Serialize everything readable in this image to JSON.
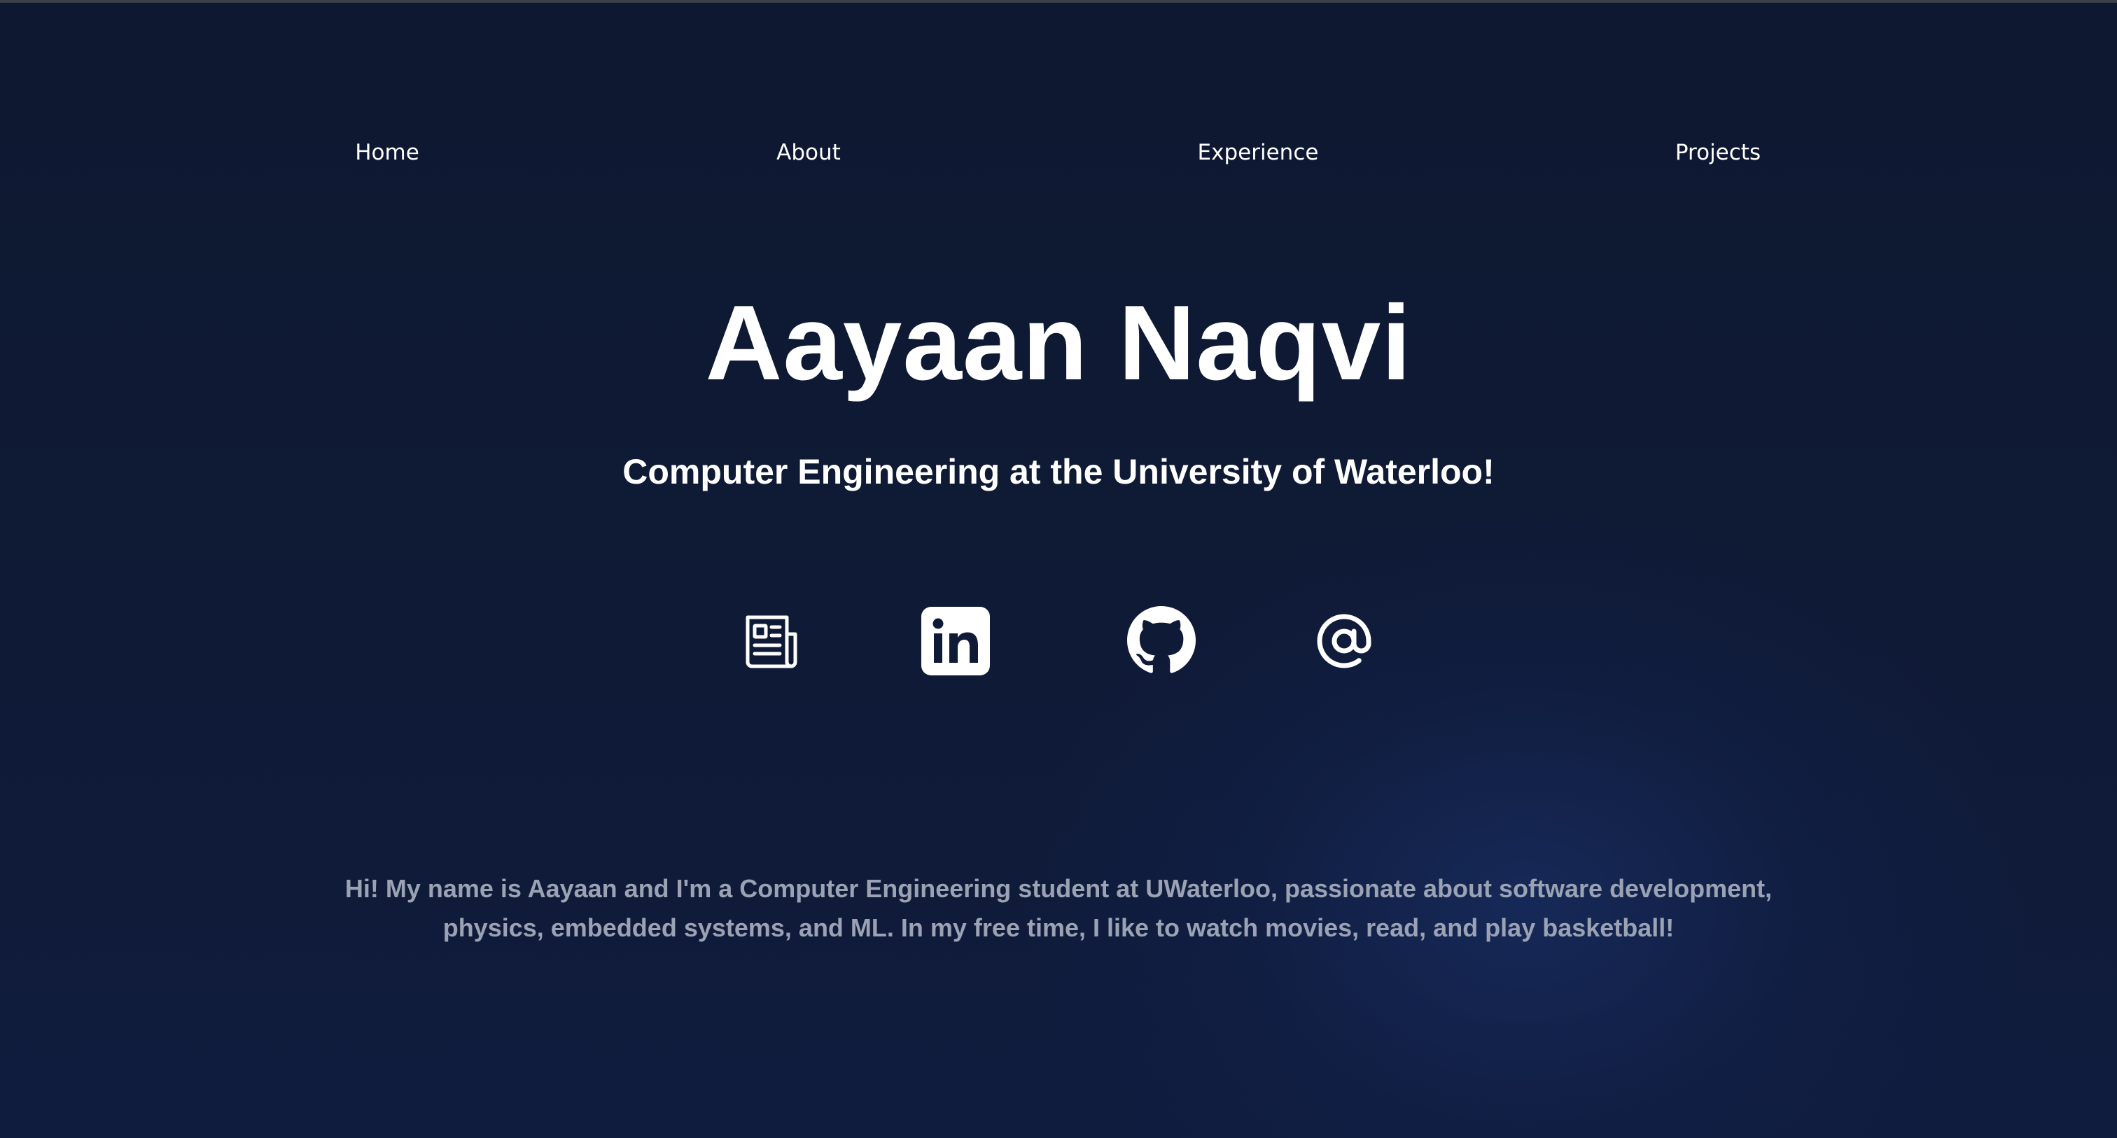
{
  "nav": {
    "items": [
      {
        "label": "Home"
      },
      {
        "label": "About"
      },
      {
        "label": "Experience"
      },
      {
        "label": "Projects"
      }
    ]
  },
  "hero": {
    "name": "Aayaan Naqvi",
    "subtitle": "Computer Engineering at the University of Waterloo!"
  },
  "social": [
    {
      "icon": "newspaper-icon",
      "label": "Resume"
    },
    {
      "icon": "linkedin-icon",
      "label": "LinkedIn"
    },
    {
      "icon": "github-icon",
      "label": "GitHub"
    },
    {
      "icon": "at-sign-icon",
      "label": "Email"
    }
  ],
  "bio": {
    "text": "Hi! My name is Aayaan and I'm a Computer Engineering student at UWaterloo, passionate about software development, physics, embedded systems, and ML. In my free time, I like to watch movies, read, and play basketball!"
  },
  "colors": {
    "background": "#0f1a36",
    "accent_glow": "#1c3470",
    "text": "#ffffff",
    "muted_text": "#9aa2b3"
  }
}
